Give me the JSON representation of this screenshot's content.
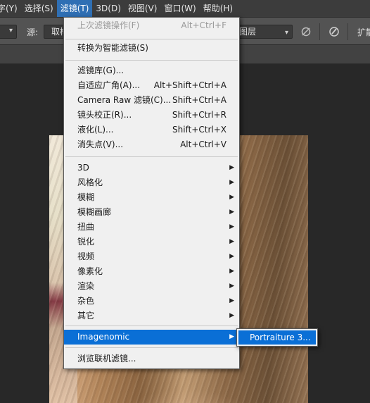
{
  "menubar": {
    "items": [
      "字(Y)",
      "选择(S)",
      "滤镜(T)",
      "3D(D)",
      "视图(V)",
      "窗口(W)",
      "帮助(H)"
    ],
    "active_index": 2
  },
  "options_bar": {
    "source_label": "源:",
    "source_value": "取样",
    "layer_select": "图层",
    "right_text": "扩散"
  },
  "filter_menu": {
    "groups": [
      [
        {
          "label": "上次滤镜操作(F)",
          "shortcut": "Alt+Ctrl+F",
          "disabled": true
        }
      ],
      [
        {
          "label": "转换为智能滤镜(S)",
          "shortcut": ""
        }
      ],
      [
        {
          "label": "滤镜库(G)...",
          "shortcut": ""
        },
        {
          "label": "自适应广角(A)...",
          "shortcut": "Alt+Shift+Ctrl+A"
        },
        {
          "label": "Camera Raw 滤镜(C)...",
          "shortcut": "Shift+Ctrl+A"
        },
        {
          "label": "镜头校正(R)...",
          "shortcut": "Shift+Ctrl+R"
        },
        {
          "label": "液化(L)...",
          "shortcut": "Shift+Ctrl+X"
        },
        {
          "label": "消失点(V)...",
          "shortcut": "Alt+Ctrl+V"
        }
      ],
      [
        {
          "label": "3D",
          "submenu": true
        },
        {
          "label": "风格化",
          "submenu": true
        },
        {
          "label": "模糊",
          "submenu": true
        },
        {
          "label": "模糊画廊",
          "submenu": true
        },
        {
          "label": "扭曲",
          "submenu": true
        },
        {
          "label": "锐化",
          "submenu": true
        },
        {
          "label": "视频",
          "submenu": true
        },
        {
          "label": "像素化",
          "submenu": true
        },
        {
          "label": "渲染",
          "submenu": true
        },
        {
          "label": "杂色",
          "submenu": true
        },
        {
          "label": "其它",
          "submenu": true
        }
      ],
      [
        {
          "label": "Imagenomic",
          "submenu": true,
          "highlighted": true
        }
      ],
      [
        {
          "label": "浏览联机滤镜...",
          "shortcut": ""
        }
      ]
    ]
  },
  "submenu": {
    "items": [
      "Portraiture 3..."
    ]
  },
  "icons": {
    "submenu_arrow": "triangle-right-icon",
    "dropdown": "chevron-down-icon"
  },
  "colors": {
    "highlight": "#0a6fd6",
    "menu_bg": "#f0f0f0",
    "menubar_bg": "#3c3c3c",
    "options_bg": "#535353"
  }
}
